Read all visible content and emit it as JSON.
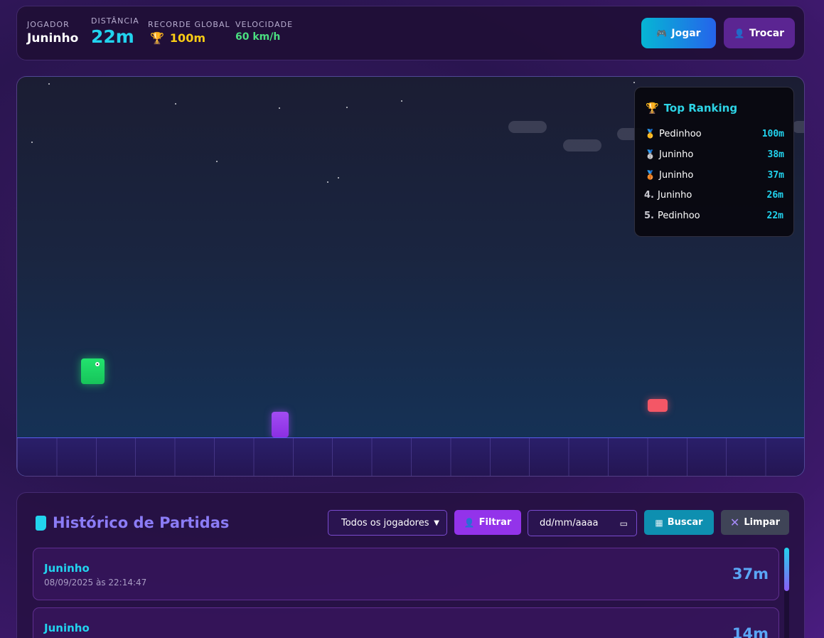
{
  "hud": {
    "player_label": "JOGADOR",
    "player_name": "Juninho",
    "distance_label": "DISTÂNCIA",
    "distance_value": "22m",
    "record_label": "RECORDE GLOBAL",
    "record_value": "100m",
    "speed_label": "VELOCIDADE",
    "speed_value": "60 km/h",
    "play_button": "Jogar",
    "switch_button": "Trocar"
  },
  "ranking": {
    "title": "Top Ranking",
    "entries": [
      {
        "pos": "🥇",
        "name": "Pedinhoo",
        "score": "100m"
      },
      {
        "pos": "🥈",
        "name": "Juninho",
        "score": "38m"
      },
      {
        "pos": "🥉",
        "name": "Juninho",
        "score": "37m"
      },
      {
        "pos": "4.",
        "name": "Juninho",
        "score": "26m"
      },
      {
        "pos": "5.",
        "name": "Pedinhoo",
        "score": "22m"
      }
    ]
  },
  "history": {
    "title": "Histórico de Partidas",
    "player_select": "Todos os jogadores",
    "filter_button": "Filtrar",
    "date_placeholder": "dd/mm/aaaa",
    "search_button": "Buscar",
    "clear_button": "Limpar",
    "matches": [
      {
        "name": "Juninho",
        "date": "08/09/2025 às 22:14:47",
        "distance": "37m"
      },
      {
        "name": "Juninho",
        "date": "",
        "distance": "14m"
      }
    ]
  },
  "colors": {
    "accent_cyan": "#22d3ee",
    "accent_purple": "#9333ea",
    "record_gold": "#facc15",
    "speed_green": "#4ade80",
    "player_green": "#22e36e",
    "obstacle_red": "#f45766"
  },
  "icons": {
    "play": "gamepad-icon",
    "switch": "user-icon",
    "record": "trophy-icon",
    "ranking": "trophy-icon",
    "history": "scroll-icon",
    "filter": "user-icon",
    "search": "calendar-icon",
    "clear": "x-icon"
  }
}
